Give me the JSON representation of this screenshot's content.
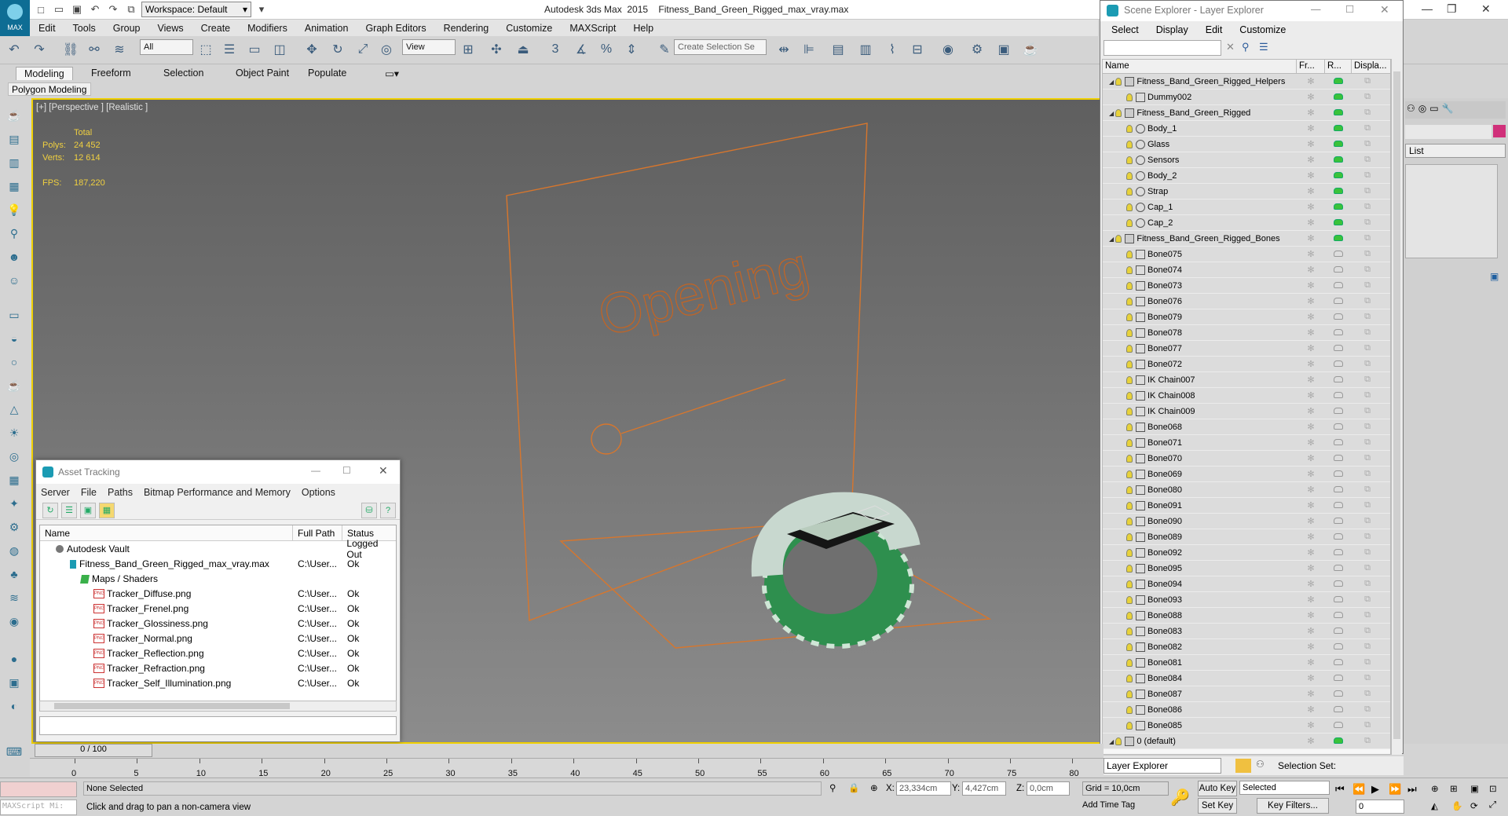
{
  "window": {
    "title": "Autodesk 3ds Max  2015    Fitness_Band_Green_Rigged_max_vray.max",
    "workspace": "Workspace: Default",
    "logo": "MAX"
  },
  "menu": [
    "Edit",
    "Tools",
    "Group",
    "Views",
    "Create",
    "Modifiers",
    "Animation",
    "Graph Editors",
    "Rendering",
    "Customize",
    "MAXScript",
    "Help"
  ],
  "toolbar": {
    "selection_filter": "All",
    "ref_coord": "View",
    "selection_set_placeholder": "Create Selection Se",
    "snap_label": "3"
  },
  "ribbon": {
    "tabs": [
      "Modeling",
      "Freeform",
      "Selection",
      "Object Paint",
      "Populate"
    ],
    "active": "Modeling",
    "panel_label": "Polygon Modeling"
  },
  "viewport": {
    "label": "[+] [Perspective ] [Realistic ]",
    "stats": {
      "total_label": "Total",
      "polys_label": "Polys:",
      "polys": "24 452",
      "verts_label": "Verts:",
      "verts": "12 614",
      "fps_label": "FPS:",
      "fps": "187,220"
    },
    "overlay_text": "Opening",
    "accent_color": "#d8762c"
  },
  "asset_tracking": {
    "title": "Asset Tracking",
    "menu": [
      "Server",
      "File",
      "Paths",
      "Bitmap Performance and Memory",
      "Options"
    ],
    "columns": [
      "Name",
      "Full Path",
      "Status"
    ],
    "rows": [
      {
        "name": "Autodesk Vault",
        "path": "",
        "status": "Logged Out",
        "icon": "vault-icon"
      },
      {
        "name": "Fitness_Band_Green_Rigged_max_vray.max",
        "path": "C:\\User...",
        "status": "Ok",
        "icon": "max-file-icon"
      },
      {
        "name": "Maps / Shaders",
        "path": "",
        "status": "",
        "icon": "maps-folder-icon"
      },
      {
        "name": "Tracker_Diffuse.png",
        "path": "C:\\User...",
        "status": "Ok",
        "icon": "png-icon"
      },
      {
        "name": "Tracker_Frenel.png",
        "path": "C:\\User...",
        "status": "Ok",
        "icon": "png-icon"
      },
      {
        "name": "Tracker_Glossiness.png",
        "path": "C:\\User...",
        "status": "Ok",
        "icon": "png-icon"
      },
      {
        "name": "Tracker_Normal.png",
        "path": "C:\\User...",
        "status": "Ok",
        "icon": "png-icon"
      },
      {
        "name": "Tracker_Reflection.png",
        "path": "C:\\User...",
        "status": "Ok",
        "icon": "png-icon"
      },
      {
        "name": "Tracker_Refraction.png",
        "path": "C:\\User...",
        "status": "Ok",
        "icon": "png-icon"
      },
      {
        "name": "Tracker_Self_Illumination.png",
        "path": "C:\\User...",
        "status": "Ok",
        "icon": "png-icon"
      }
    ]
  },
  "scene_explorer": {
    "title": "Scene Explorer - Layer Explorer",
    "menu": [
      "Select",
      "Display",
      "Edit",
      "Customize"
    ],
    "columns": [
      "Name",
      "Fr...",
      "R...",
      "Displa..."
    ],
    "items": [
      {
        "name": "Fitness_Band_Green_Rigged_Helpers",
        "level": 0,
        "kind": "layer"
      },
      {
        "name": "Dummy002",
        "level": 1,
        "kind": "helper"
      },
      {
        "name": "Fitness_Band_Green_Rigged",
        "level": 0,
        "kind": "layer"
      },
      {
        "name": "Body_1",
        "level": 1,
        "kind": "geo"
      },
      {
        "name": "Glass",
        "level": 1,
        "kind": "geo"
      },
      {
        "name": "Sensors",
        "level": 1,
        "kind": "geo"
      },
      {
        "name": "Body_2",
        "level": 1,
        "kind": "geo"
      },
      {
        "name": "Strap",
        "level": 1,
        "kind": "geo"
      },
      {
        "name": "Cap_1",
        "level": 1,
        "kind": "geo"
      },
      {
        "name": "Cap_2",
        "level": 1,
        "kind": "geo"
      },
      {
        "name": "Fitness_Band_Green_Rigged_Bones",
        "level": 0,
        "kind": "layer"
      },
      {
        "name": "Bone075",
        "level": 1,
        "kind": "bone"
      },
      {
        "name": "Bone074",
        "level": 1,
        "kind": "bone"
      },
      {
        "name": "Bone073",
        "level": 1,
        "kind": "bone"
      },
      {
        "name": "Bone076",
        "level": 1,
        "kind": "bone"
      },
      {
        "name": "Bone079",
        "level": 1,
        "kind": "bone"
      },
      {
        "name": "Bone078",
        "level": 1,
        "kind": "bone"
      },
      {
        "name": "Bone077",
        "level": 1,
        "kind": "bone"
      },
      {
        "name": "Bone072",
        "level": 1,
        "kind": "bone"
      },
      {
        "name": "IK Chain007",
        "level": 1,
        "kind": "ik"
      },
      {
        "name": "IK Chain008",
        "level": 1,
        "kind": "ik"
      },
      {
        "name": "IK Chain009",
        "level": 1,
        "kind": "ik"
      },
      {
        "name": "Bone068",
        "level": 1,
        "kind": "bone"
      },
      {
        "name": "Bone071",
        "level": 1,
        "kind": "bone"
      },
      {
        "name": "Bone070",
        "level": 1,
        "kind": "bone"
      },
      {
        "name": "Bone069",
        "level": 1,
        "kind": "bone"
      },
      {
        "name": "Bone080",
        "level": 1,
        "kind": "bone"
      },
      {
        "name": "Bone091",
        "level": 1,
        "kind": "bone"
      },
      {
        "name": "Bone090",
        "level": 1,
        "kind": "bone"
      },
      {
        "name": "Bone089",
        "level": 1,
        "kind": "bone"
      },
      {
        "name": "Bone092",
        "level": 1,
        "kind": "bone"
      },
      {
        "name": "Bone095",
        "level": 1,
        "kind": "bone"
      },
      {
        "name": "Bone094",
        "level": 1,
        "kind": "bone"
      },
      {
        "name": "Bone093",
        "level": 1,
        "kind": "bone"
      },
      {
        "name": "Bone088",
        "level": 1,
        "kind": "bone"
      },
      {
        "name": "Bone083",
        "level": 1,
        "kind": "bone"
      },
      {
        "name": "Bone082",
        "level": 1,
        "kind": "bone"
      },
      {
        "name": "Bone081",
        "level": 1,
        "kind": "bone"
      },
      {
        "name": "Bone084",
        "level": 1,
        "kind": "bone"
      },
      {
        "name": "Bone087",
        "level": 1,
        "kind": "bone"
      },
      {
        "name": "Bone086",
        "level": 1,
        "kind": "bone"
      },
      {
        "name": "Bone085",
        "level": 1,
        "kind": "bone"
      },
      {
        "name": "0 (default)",
        "level": 0,
        "kind": "layer"
      }
    ],
    "footer_explorer": "Layer Explorer",
    "footer_selection_set": "Selection Set:"
  },
  "command_panel": {
    "dropdown": "List"
  },
  "timeline": {
    "slider": "0 / 100",
    "ticks": [
      "0",
      "5",
      "10",
      "15",
      "20",
      "25",
      "30",
      "35",
      "40",
      "45",
      "50",
      "55",
      "60",
      "65",
      "70",
      "75",
      "80"
    ]
  },
  "status": {
    "maxscript": "MAXScript Mi:",
    "selection": "None Selected",
    "prompt": "Click and drag to pan a non-camera view",
    "x_label": "X:",
    "x": "23,334cm",
    "y_label": "Y:",
    "y": "4,427cm",
    "z_label": "Z:",
    "z": "0,0cm",
    "grid": "Grid = 10,0cm",
    "add_time_tag": "Add Time Tag",
    "auto_key": "Auto Key",
    "set_key": "Set Key",
    "key_mode": "Selected",
    "key_filters": "Key Filters...",
    "frame": "0"
  }
}
